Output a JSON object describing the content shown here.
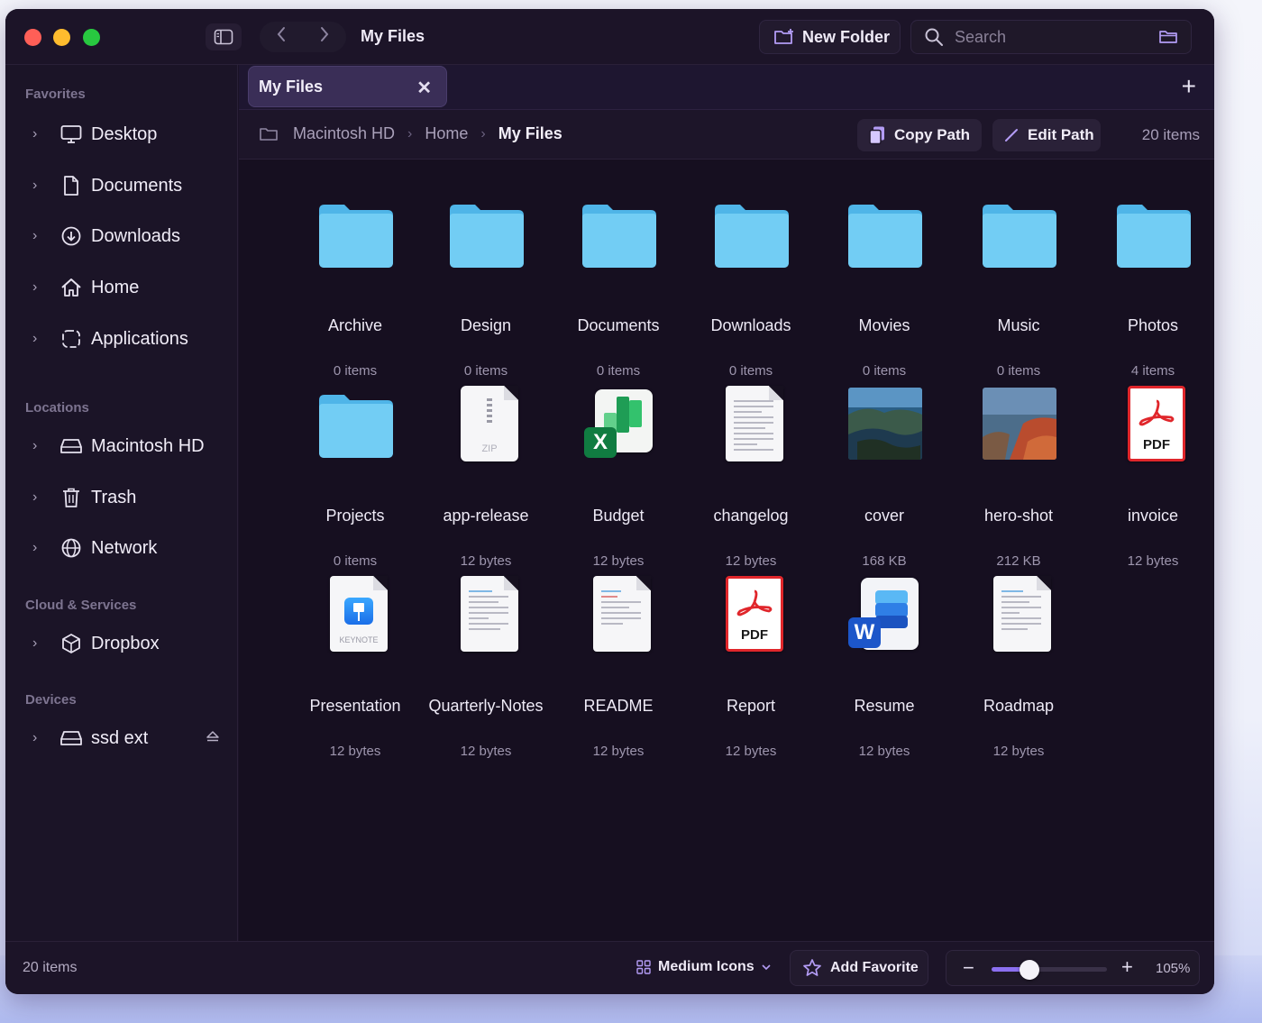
{
  "window": {
    "title": "My Files",
    "new_folder_label": "New Folder",
    "search_placeholder": "Search"
  },
  "sidebar": {
    "sections": [
      {
        "title": "Favorites",
        "items": [
          {
            "label": "Desktop",
            "icon": "desktop-icon"
          },
          {
            "label": "Documents",
            "icon": "document-icon"
          },
          {
            "label": "Downloads",
            "icon": "download-icon"
          },
          {
            "label": "Home",
            "icon": "home-icon"
          },
          {
            "label": "Applications",
            "icon": "applications-icon"
          }
        ]
      },
      {
        "title": "Locations",
        "items": [
          {
            "label": "Macintosh HD",
            "icon": "drive-icon"
          },
          {
            "label": "Trash",
            "icon": "trash-icon"
          },
          {
            "label": "Network",
            "icon": "globe-icon"
          }
        ]
      },
      {
        "title": "Cloud & Services",
        "items": [
          {
            "label": "Dropbox",
            "icon": "box-icon"
          }
        ]
      },
      {
        "title": "Devices",
        "items": [
          {
            "label": "ssd ext",
            "icon": "drive-icon"
          }
        ]
      }
    ]
  },
  "tabs": [
    {
      "label": "My Files"
    }
  ],
  "pathbar": {
    "crumbs": [
      "Macintosh HD",
      "Home",
      "My Files"
    ],
    "copy_path_label": "Copy Path",
    "edit_path_label": "Edit Path",
    "count": "20 items"
  },
  "files": [
    {
      "name": "Archive",
      "meta": "0 items",
      "kind": "folder"
    },
    {
      "name": "Design",
      "meta": "0 items",
      "kind": "folder"
    },
    {
      "name": "Documents",
      "meta": "0 items",
      "kind": "folder"
    },
    {
      "name": "Downloads",
      "meta": "0 items",
      "kind": "folder"
    },
    {
      "name": "Movies",
      "meta": "0 items",
      "kind": "folder"
    },
    {
      "name": "Music",
      "meta": "0 items",
      "kind": "folder"
    },
    {
      "name": "Photos",
      "meta": "4 items",
      "kind": "folder"
    },
    {
      "name": "Projects",
      "meta": "0 items",
      "kind": "folder"
    },
    {
      "name": "app-release",
      "meta": "12 bytes",
      "kind": "zip",
      "badge": "ZIP"
    },
    {
      "name": "Budget",
      "meta": "12 bytes",
      "kind": "excel",
      "badge": "X"
    },
    {
      "name": "changelog",
      "meta": "12 bytes",
      "kind": "text"
    },
    {
      "name": "cover",
      "meta": "168 KB",
      "kind": "photo-coast"
    },
    {
      "name": "hero-shot",
      "meta": "212 KB",
      "kind": "photo-rocks"
    },
    {
      "name": "invoice",
      "meta": "12 bytes",
      "kind": "pdf",
      "badge": "PDF"
    },
    {
      "name": "Presentation",
      "meta": "12 bytes",
      "kind": "keynote",
      "badge": "KEYNOTE"
    },
    {
      "name": "Quarterly-Notes",
      "meta": "12 bytes",
      "kind": "text"
    },
    {
      "name": "README",
      "meta": "12 bytes",
      "kind": "text"
    },
    {
      "name": "Report",
      "meta": "12 bytes",
      "kind": "pdf",
      "badge": "PDF"
    },
    {
      "name": "Resume",
      "meta": "12 bytes",
      "kind": "word",
      "badge": "W"
    },
    {
      "name": "Roadmap",
      "meta": "12 bytes",
      "kind": "text"
    }
  ],
  "statusbar": {
    "count": "20 items",
    "view_mode": "Medium Icons",
    "add_favorite_label": "Add Favorite",
    "zoom_label": "105%",
    "zoom_fraction": 0.33
  },
  "colors": {
    "accent": "#8b6ff0",
    "folder": "#6ec9f3",
    "pdf_red": "#e0262b"
  }
}
